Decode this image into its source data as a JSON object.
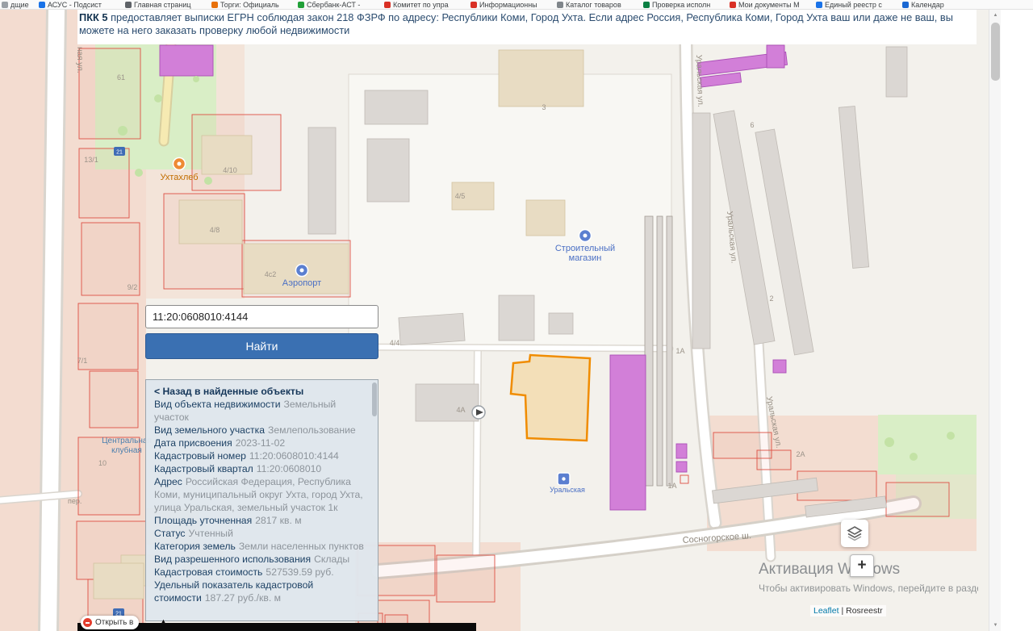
{
  "colors": {
    "accent_button_blue": "#3a70b2",
    "panel_bg": "#dfe6ec",
    "selected_parcel_orange": "#f08c00",
    "purple_building": "#d27fd8",
    "pink_cadastral_zone": "#f2d8cb",
    "map_green": "#d9eec6",
    "label_navy": "#1e4265",
    "value_gray": "#8d949b",
    "poi_blue": "#4a6fc4",
    "poi_orange": "#c26d00",
    "red_parcel_outline": "#dd5044"
  },
  "bookmarks": {
    "items": [
      {
        "label": "дщие"
      },
      {
        "label": "АСУС - Подсист"
      },
      {
        "label": "Главная страниц"
      },
      {
        "label": "Торги: Официаль"
      },
      {
        "label": "Сбербанк-АСТ -"
      },
      {
        "label": "Комитет по упра"
      },
      {
        "label": "Информационны"
      },
      {
        "label": "Каталог товаров"
      },
      {
        "label": "Проверка исполн"
      },
      {
        "label": "Мои документы М"
      },
      {
        "label": "Единый реестр с"
      },
      {
        "label": "Календар"
      }
    ]
  },
  "header": {
    "brand": "ПКК 5",
    "line": "предоставляет выписки ЕГРН соблюдая закон 218 ФЗРФ по адресу: Республики Коми, Город Ухта. Если адрес Россия, Республика Коми, Город Ухта ваш или даже не ваш, вы можете на него заказать проверку любой недвижимости"
  },
  "search": {
    "value": "11:20:0608010:4144",
    "button": "Найти"
  },
  "panel": {
    "back_link": "< Назад в найденные объекты",
    "rows": [
      {
        "label": "Вид объекта недвижимости",
        "value": "Земельный участок"
      },
      {
        "label": "Вид земельного участка",
        "value": "Землепользование"
      },
      {
        "label": "Дата присвоения",
        "value": "2023-11-02"
      },
      {
        "label": "Кадастровый номер",
        "value": "11:20:0608010:4144"
      },
      {
        "label": "Кадастровый квартал",
        "value": "11:20:0608010"
      },
      {
        "label": "Адрес",
        "value": "Российская Федерация, Республика Коми, муниципальный округ Ухта, город Ухта, улица Уральская, земельный участок 1к"
      },
      {
        "label": "Площадь уточненная",
        "value": "2817 кв. м"
      },
      {
        "label": "Статус",
        "value": "Учтенный"
      },
      {
        "label": "Категория земель",
        "value": "Земли населенных пунктов"
      },
      {
        "label": "Вид разрешенного использования",
        "value": "Склады"
      },
      {
        "label": "Кадастровая стоимость",
        "value": "527539.59 руб."
      },
      {
        "label": "Удельный показатель кадастровой стоимости",
        "value": "187.27 руб./кв. м"
      }
    ],
    "scroll_up": "▲"
  },
  "map": {
    "poi": {
      "bakery": "Ухтахлеб",
      "airport": "Аэропорт",
      "store_line1": "Строительный",
      "store_line2": "магазин",
      "uralskaya_marker": "Уральская",
      "club_line1": "Центральная",
      "club_line2": "клубная"
    },
    "streets": [
      "ная ул.",
      "Уральская ул.",
      "Уральская ул.",
      "Уральская ул.",
      "Сосногорское ш.",
      "пер."
    ],
    "house_numbers": [
      "61",
      "13/1",
      "4/10",
      "4/8",
      "9/2",
      "4с2",
      "7/1",
      "10",
      "3",
      "4/5",
      "4/4",
      "4А",
      "6",
      "2",
      "1А",
      "1А",
      "2А"
    ],
    "transit": [
      "21",
      "21"
    ],
    "attribution": {
      "leaflet": "Leaflet",
      "divider": "|",
      "source": "Rosreestr"
    }
  },
  "controls": {
    "zoom_in": "+",
    "open_in": "Открыть в"
  },
  "icons": {
    "scroll_up": "▲",
    "scroll_down": "▼"
  },
  "watermark": {
    "line1": "Активация Windows",
    "line2": "Чтобы активировать Windows, перейдите в раздел \"Парам"
  }
}
